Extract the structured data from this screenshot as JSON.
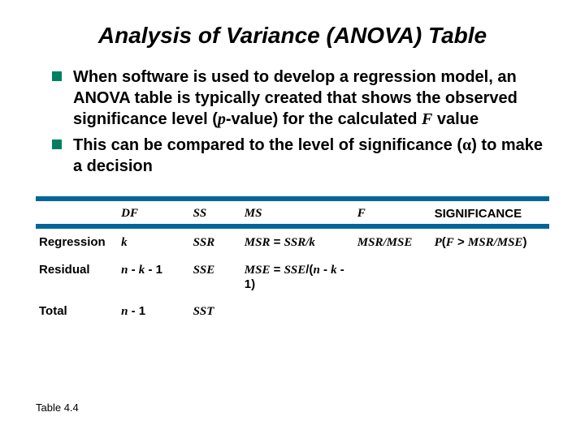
{
  "title": "Analysis of Variance (ANOVA) Table",
  "bullets": {
    "b1_a": "When software is used to develop a regression model, an ANOVA table is typically created that shows the observed significance level (",
    "b1_p": "p",
    "b1_b": "-value) for the calculated ",
    "b1_F": "F",
    "b1_c": " value",
    "b2_a": "This can be compared to the level of significance (",
    "b2_alpha": "α",
    "b2_b": ") to make a decision"
  },
  "headers": {
    "blank": "",
    "df": "DF",
    "ss": "SS",
    "ms": "MS",
    "f": "F",
    "sig": "SIGNIFICANCE"
  },
  "rows": {
    "reg": {
      "label": "Regression",
      "df": "k",
      "ss": "SSR",
      "ms_a": "MSR",
      "ms_eq": " = ",
      "ms_b": "SSR/k",
      "f": "MSR/MSE",
      "sig_a": "P",
      "sig_paren": "(",
      "sig_F": "F",
      "sig_gt": " > ",
      "sig_b": "MSR/MSE",
      "sig_close": ")"
    },
    "res": {
      "label": "Residual",
      "df_a": "n",
      "df_mid": " - ",
      "df_b": "k",
      "df_end": " - 1",
      "ss": "SSE",
      "ms_a": "MSE",
      "ms_eq": " = ",
      "ms_b": "SSE",
      "ms_div": "/(",
      "ms_n": "n",
      "ms_mid": " - ",
      "ms_k": "k",
      "ms_end": " - 1)"
    },
    "tot": {
      "label": "Total",
      "df_a": "n",
      "df_end": " - 1",
      "ss": "SST"
    }
  },
  "caption": "Table 4.4",
  "chart_data": {
    "type": "table",
    "title": "Analysis of Variance (ANOVA) Table",
    "columns": [
      "",
      "DF",
      "SS",
      "MS",
      "F",
      "SIGNIFICANCE"
    ],
    "rows": [
      [
        "Regression",
        "k",
        "SSR",
        "MSR = SSR/k",
        "MSR/MSE",
        "P(F > MSR/MSE)"
      ],
      [
        "Residual",
        "n - k - 1",
        "SSE",
        "MSE = SSE/(n - k - 1)",
        "",
        ""
      ],
      [
        "Total",
        "n - 1",
        "SST",
        "",
        "",
        ""
      ]
    ]
  }
}
